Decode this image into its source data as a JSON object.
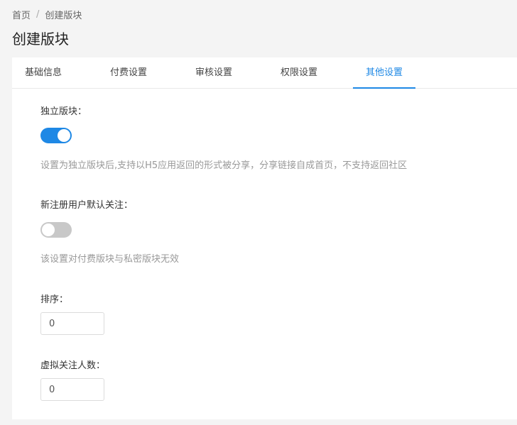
{
  "breadcrumb": {
    "home": "首页",
    "separator": "/",
    "current": "创建版块"
  },
  "page_title": "创建版块",
  "tabs": [
    {
      "label": "基础信息",
      "active": false
    },
    {
      "label": "付费设置",
      "active": false
    },
    {
      "label": "审核设置",
      "active": false
    },
    {
      "label": "权限设置",
      "active": false
    },
    {
      "label": "其他设置",
      "active": true
    }
  ],
  "form": {
    "independent": {
      "label": "独立版块：",
      "enabled": true,
      "hint": "设置为独立版块后,支持以H5应用返回的形式被分享，分享链接自成首页，不支持返回社区"
    },
    "auto_follow": {
      "label": "新注册用户默认关注：",
      "enabled": false,
      "hint": "该设置对付费版块与私密版块无效"
    },
    "sort": {
      "label": "排序：",
      "value": "0"
    },
    "virtual_followers": {
      "label": "虚拟关注人数：",
      "value": "0"
    }
  },
  "colors": {
    "accent": "#1e88e5",
    "switch_off": "#c8c8c8",
    "hint": "#999999",
    "background": "#f4f4f4"
  }
}
